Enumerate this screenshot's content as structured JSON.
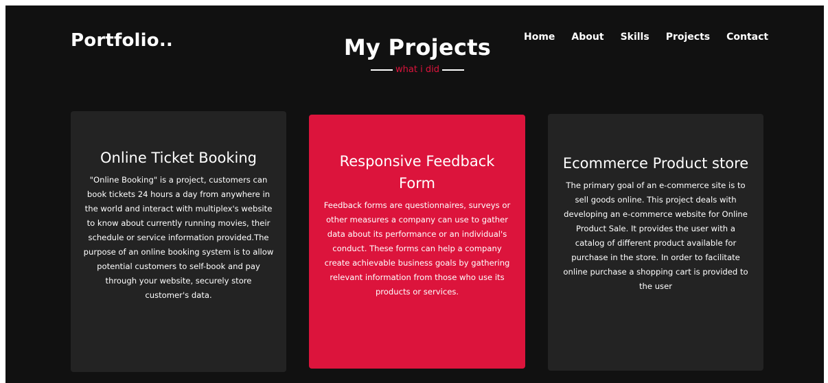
{
  "header": {
    "logo": "Portfolio..",
    "nav": [
      "Home",
      "About",
      "Skills",
      "Projects",
      "Contact"
    ]
  },
  "section": {
    "title": "My Projects",
    "subtitle": "what i did"
  },
  "projects": [
    {
      "title": "Online Ticket Booking",
      "description": "\"Online Booking\" is a project, customers can book tickets 24 hours a day from anywhere in the world and interact with multiplex's website to know about currently running movies, their schedule or service information provided.The purpose of an online booking system is to allow potential customers to self-book and pay through your website, securely store customer's data."
    },
    {
      "title": "Responsive Feedback Form",
      "description": "Feedback forms are questionnaires, surveys or other measures a company can use to gather data about its performance or an individual's conduct. These forms can help a company create achievable business goals by gathering relevant information from those who use its products or services."
    },
    {
      "title": "Ecommerce Product store",
      "description": "The primary goal of an e-commerce site is to sell goods online. This project deals with developing an e-commerce website for Online Product Sale. It provides the user with a catalog of different product available for purchase in the store. In order to facilitate online purchase a shopping cart is provided to the user"
    }
  ],
  "colors": {
    "background": "#111111",
    "card": "#232323",
    "accent": "#dc143c"
  }
}
